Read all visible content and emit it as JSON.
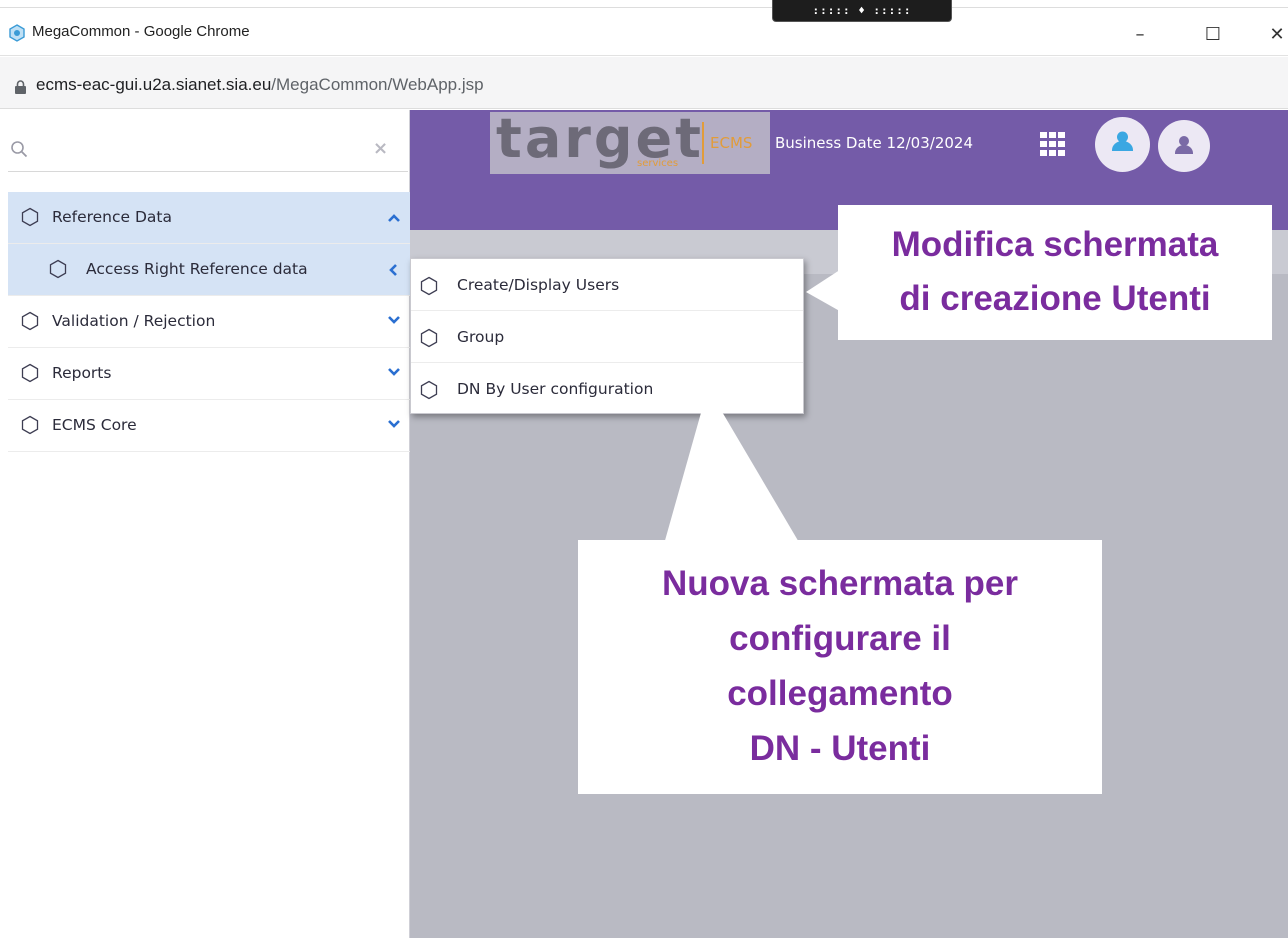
{
  "window": {
    "title": "MegaCommon - Google Chrome",
    "controls": {
      "minimize": "–",
      "maximize": "☐",
      "close": "✕"
    },
    "drag_handle": "::::: ♦ :::::"
  },
  "address_bar": {
    "url_main": "ecms-eac-gui.u2a.sianet.sia.eu",
    "url_path": "/MegaCommon/WebApp.jsp"
  },
  "sidebar": {
    "search": {
      "value": "",
      "clear_icon": "×"
    },
    "items": [
      {
        "label": "Reference Data",
        "expanded": true
      },
      {
        "label": "Access Right Reference data",
        "open": true
      },
      {
        "label": "Validation / Rejection",
        "expanded": false
      },
      {
        "label": "Reports",
        "expanded": false
      },
      {
        "label": "ECMS Core",
        "expanded": false
      }
    ]
  },
  "header": {
    "logo_main": "target",
    "logo_sub": "services",
    "logo_product": "ECMS",
    "business_date": "Business Date 12/03/2024"
  },
  "submenu": {
    "items": [
      {
        "label": "Create/Display Users"
      },
      {
        "label": "Group"
      },
      {
        "label": "DN By User configuration"
      }
    ]
  },
  "callouts": {
    "modify": {
      "line1": "Modifica schermata",
      "line2": "di creazione Utenti"
    },
    "new": {
      "line1": "Nuova schermata per",
      "line2": "configurare il",
      "line3": "collegamento",
      "line4": "DN - Utenti"
    }
  },
  "colors": {
    "header_purple": "#745ba8",
    "callout_text": "#7a2c9e",
    "active_nav": "#d5e3f5",
    "main_bg": "#b9bac3",
    "accent_orange": "#e29c3a",
    "chevron_blue": "#2a6fd1"
  },
  "icons": {
    "app": "megacommon-app-icon",
    "lock": "lock-icon",
    "search": "search-icon",
    "nav": "hexagon-icon",
    "apps_grid": "grid-icon",
    "user_primary": "user-avatar-icon",
    "user_secondary": "user-avatar-icon"
  }
}
